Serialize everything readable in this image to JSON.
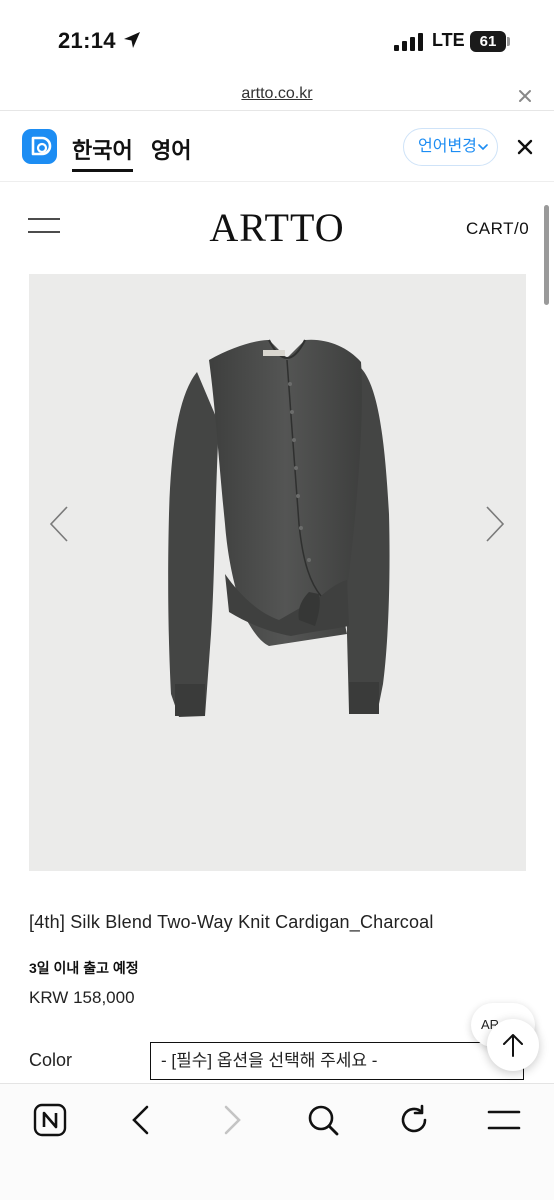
{
  "status_bar": {
    "time": "21:14",
    "network": "LTE",
    "battery": "61"
  },
  "browser": {
    "url": "artto.co.kr"
  },
  "translate_bar": {
    "tab_korean": "한국어",
    "tab_english": "영어",
    "change_language": "언어변경"
  },
  "site": {
    "logo": "ARTTO",
    "cart": "CART/0"
  },
  "product": {
    "name": "[4th] Silk Blend Two-Way Knit Cardigan_Charcoal",
    "shipping_note": "3일 이내 출고 예정",
    "price": "KRW 158,000",
    "option_label": "Color",
    "option_placeholder": "- [필수] 옵션을 선택해 주세요 -"
  },
  "floating": {
    "chip_text": "AR"
  },
  "colors": {
    "accent": "#1d8df3",
    "garment": "#4a4b4a",
    "image_bg": "#ebebea"
  }
}
